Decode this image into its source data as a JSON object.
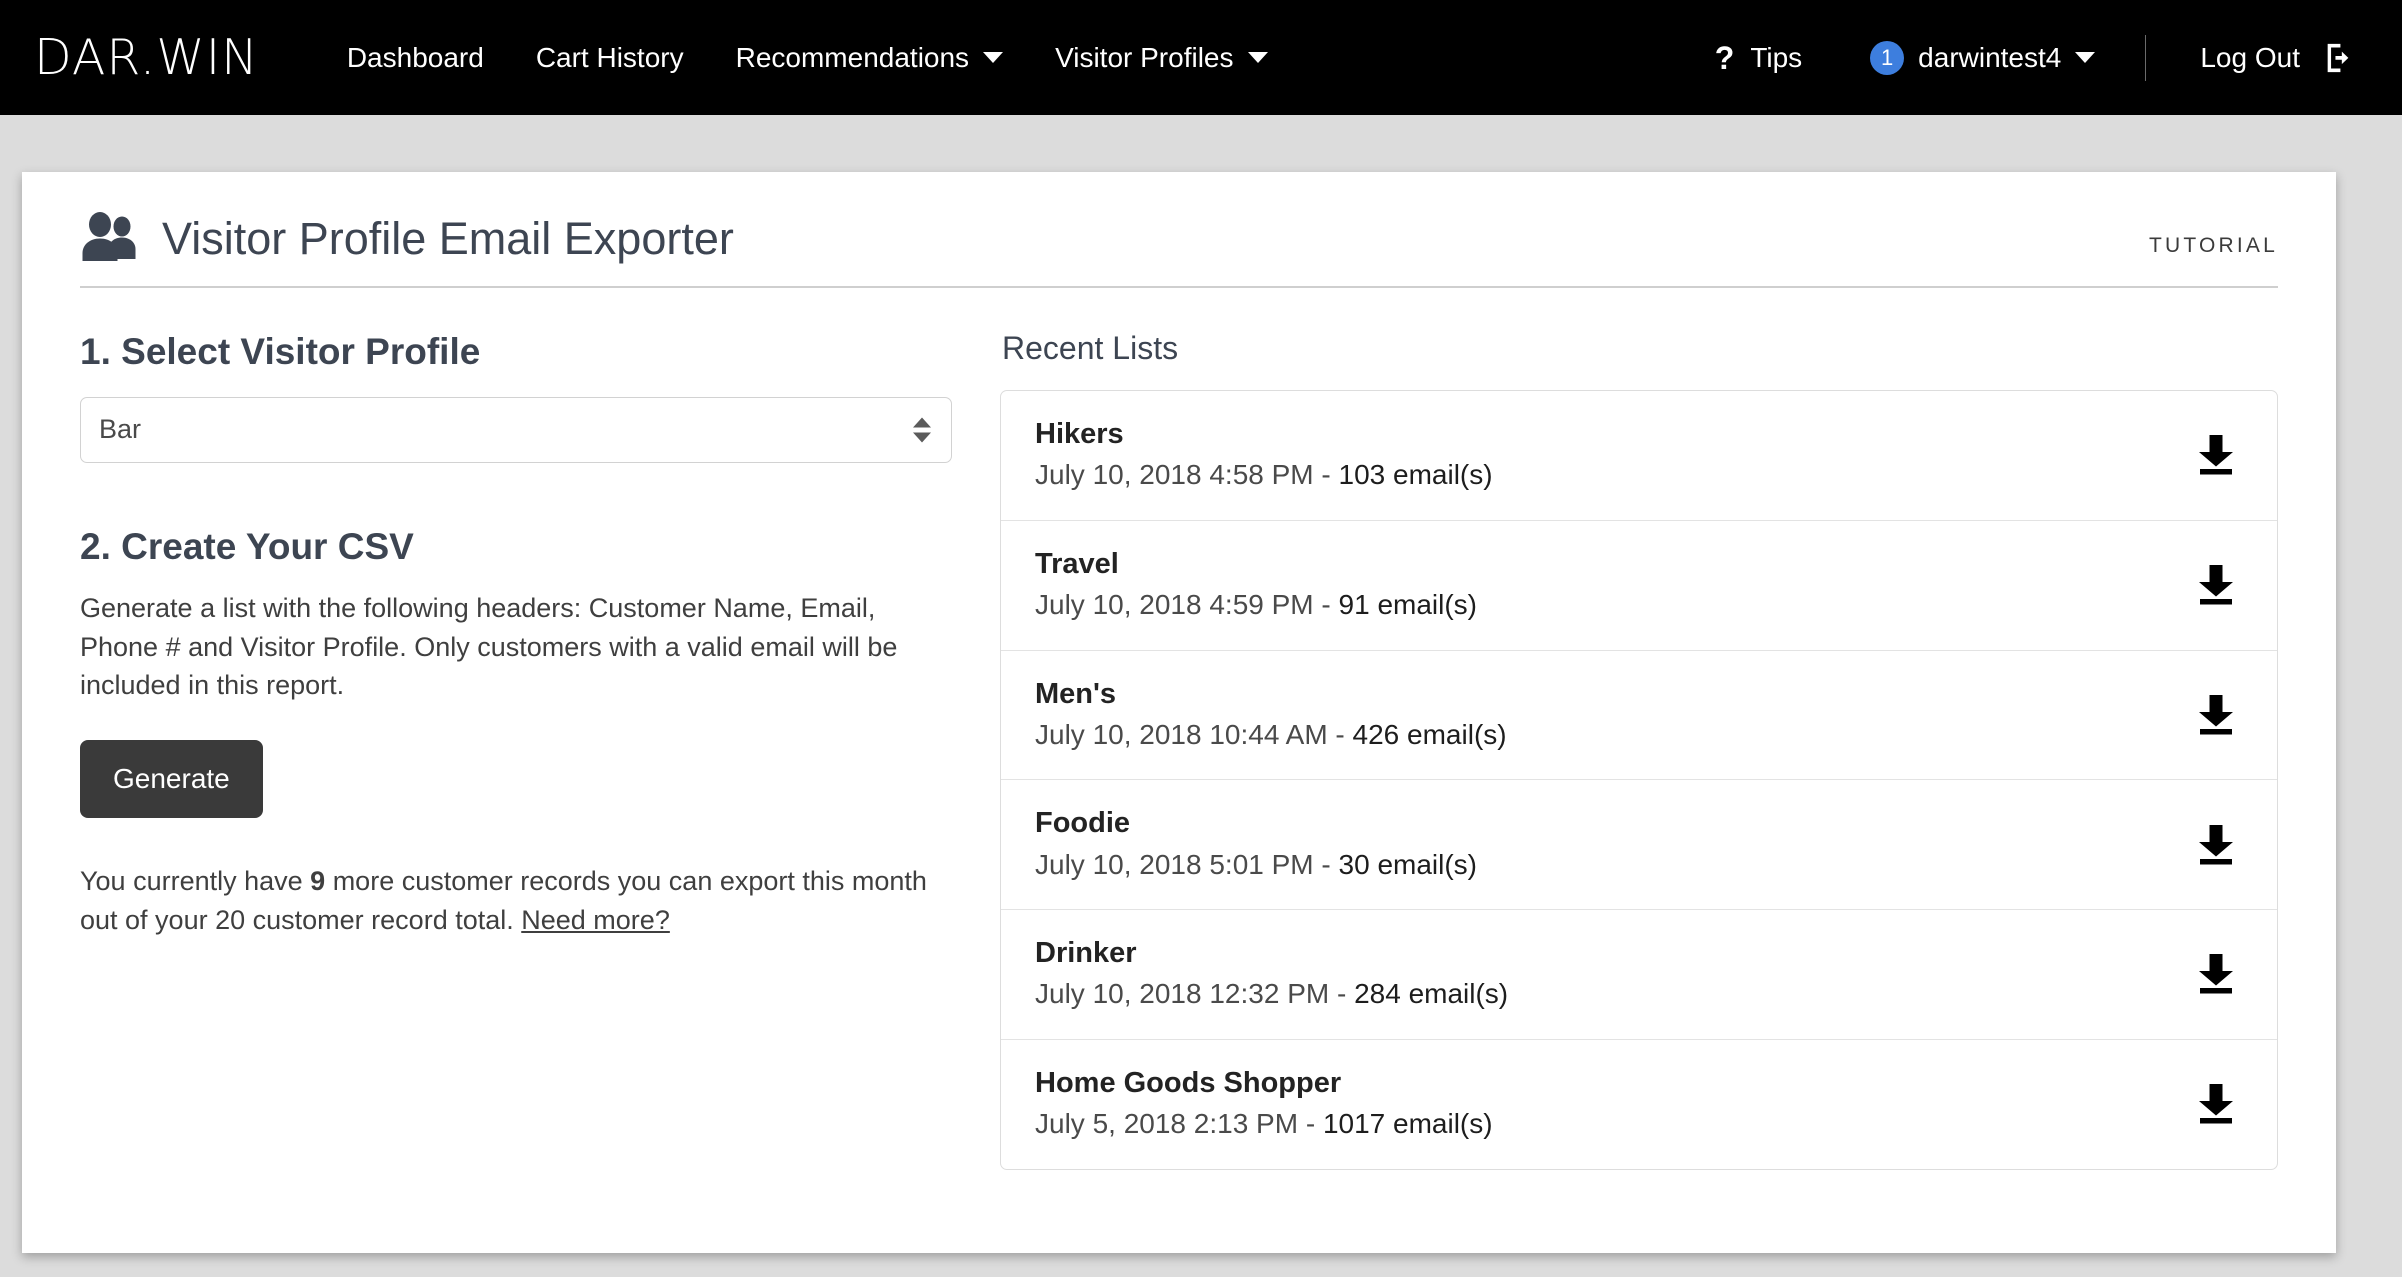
{
  "navbar": {
    "brand": "DAR.WIN",
    "items": [
      {
        "label": "Dashboard",
        "has_caret": false
      },
      {
        "label": "Cart History",
        "has_caret": false
      },
      {
        "label": "Recommendations",
        "has_caret": true
      },
      {
        "label": "Visitor Profiles",
        "has_caret": true
      }
    ],
    "tips_label": "Tips",
    "tips_icon": "question-mark-icon",
    "user": {
      "badge_count": "1",
      "name": "darwintest4",
      "badge_color": "#3d7ede"
    },
    "logout_label": "Log Out",
    "logout_icon": "logout-icon",
    "background_color": "#000000"
  },
  "card": {
    "icon": "users-icon",
    "title": "Visitor Profile Email Exporter",
    "tutorial_label": "TUTORIAL"
  },
  "select_profile": {
    "heading": "1. Select Visitor Profile",
    "selected_value": "Bar",
    "stepper_icon": "up-down-arrows-icon"
  },
  "create_csv": {
    "heading": "2. Create Your CSV",
    "description": "Generate a list with the following headers: Customer Name, Email, Phone # and Visitor Profile. Only customers with a valid email will be included in this report.",
    "generate_label": "Generate",
    "quota_prefix": "You currently have ",
    "quota_remaining": "9",
    "quota_middle": " more customer records you can export this month out of your ",
    "quota_total": "20",
    "quota_suffix": " customer record total. ",
    "need_more_label": "Need more?"
  },
  "recent_lists": {
    "heading": "Recent Lists",
    "download_icon": "download-icon",
    "rows": [
      {
        "name": "Hikers",
        "date": "July 10, 2018 4:58 PM - ",
        "count": "103 email(s)"
      },
      {
        "name": "Travel",
        "date": "July 10, 2018 4:59 PM - ",
        "count": "91 email(s)"
      },
      {
        "name": "Men's",
        "date": "July 10, 2018 10:44 AM - ",
        "count": "426 email(s)"
      },
      {
        "name": "Foodie",
        "date": "July 10, 2018 5:01 PM - ",
        "count": "30 email(s)"
      },
      {
        "name": "Drinker",
        "date": "July 10, 2018 12:32 PM - ",
        "count": "284 email(s)"
      },
      {
        "name": "Home Goods Shopper",
        "date": "July 5, 2018 2:13 PM - ",
        "count": "1017 email(s)"
      }
    ]
  }
}
